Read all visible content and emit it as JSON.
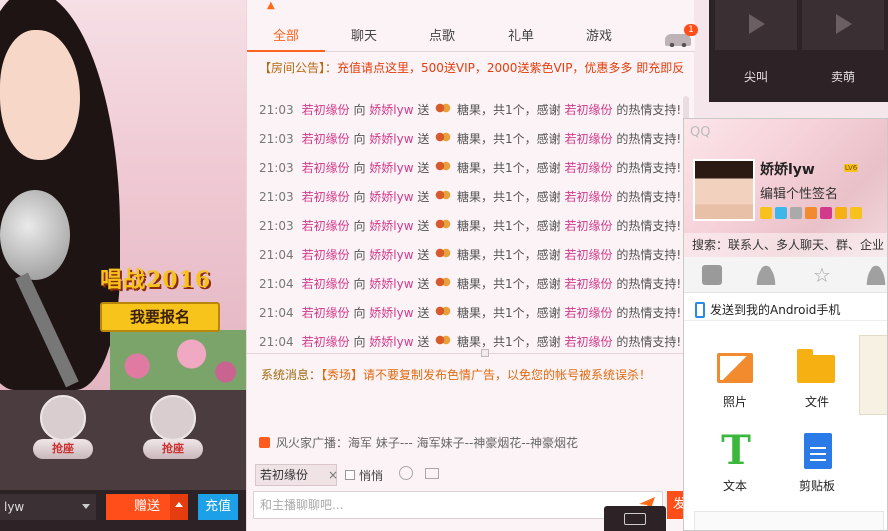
{
  "banner": {
    "title": "唱战2016",
    "button": "我要报名"
  },
  "seats": [
    {
      "label": "抢座"
    },
    {
      "label": "抢座"
    }
  ],
  "leftbar": {
    "user": "lyw",
    "gift_label": "赠送",
    "recharge_label": "充值"
  },
  "tabs": [
    {
      "label": "全部",
      "active": true
    },
    {
      "label": "聊天"
    },
    {
      "label": "点歌"
    },
    {
      "label": "礼单"
    },
    {
      "label": "游戏"
    }
  ],
  "car_badge": "1",
  "notice": {
    "label": "【房间公告】：",
    "text": "充值请点这里，500送VIP，2000送紫色VIP，优惠多多 即充即反"
  },
  "messages": [
    {
      "time": "21:03",
      "from": "若初缘份",
      "verb": "向",
      "to": "娇娇lyw",
      "send": "送",
      "rest": "糖果，共1个，感谢",
      "thank": "若初缘份",
      "tail": "的热情支持!"
    },
    {
      "time": "21:03",
      "from": "若初缘份",
      "verb": "向",
      "to": "娇娇lyw",
      "send": "送",
      "rest": "糖果，共1个，感谢",
      "thank": "若初缘份",
      "tail": "的热情支持!"
    },
    {
      "time": "21:03",
      "from": "若初缘份",
      "verb": "向",
      "to": "娇娇lyw",
      "send": "送",
      "rest": "糖果，共1个，感谢",
      "thank": "若初缘份",
      "tail": "的热情支持!"
    },
    {
      "time": "21:03",
      "from": "若初缘份",
      "verb": "向",
      "to": "娇娇lyw",
      "send": "送",
      "rest": "糖果，共1个，感谢",
      "thank": "若初缘份",
      "tail": "的热情支持!"
    },
    {
      "time": "21:03",
      "from": "若初缘份",
      "verb": "向",
      "to": "娇娇lyw",
      "send": "送",
      "rest": "糖果，共1个，感谢",
      "thank": "若初缘份",
      "tail": "的热情支持!"
    },
    {
      "time": "21:04",
      "from": "若初缘份",
      "verb": "向",
      "to": "娇娇lyw",
      "send": "送",
      "rest": "糖果，共1个，感谢",
      "thank": "若初缘份",
      "tail": "的热情支持!"
    },
    {
      "time": "21:04",
      "from": "若初缘份",
      "verb": "向",
      "to": "娇娇lyw",
      "send": "送",
      "rest": "糖果，共1个，感谢",
      "thank": "若初缘份",
      "tail": "的热情支持!"
    },
    {
      "time": "21:04",
      "from": "若初缘份",
      "verb": "向",
      "to": "娇娇lyw",
      "send": "送",
      "rest": "糖果，共1个，感谢",
      "thank": "若初缘份",
      "tail": "的热情支持!"
    },
    {
      "time": "21:04",
      "from": "若初缘份",
      "verb": "向",
      "to": "娇娇lyw",
      "send": "送",
      "rest": "糖果，共1个，感谢",
      "thank": "若初缘份",
      "tail": "的热情支持!"
    }
  ],
  "system": {
    "label": "系统消息：",
    "text": "【秀场】请不要复制发布色情广告，以免您的帐号被系统误杀！"
  },
  "broadcast": {
    "text": "风火家广播：海军 妹子--- 海军妹子--神豪烟花--神豪烟花"
  },
  "input": {
    "target": "若初缘份",
    "close": "×",
    "whisper": "悄悄",
    "placeholder": "和主播聊聊吧...",
    "send": "发"
  },
  "top_panel": [
    {
      "label": "尖叫"
    },
    {
      "label": "卖萌"
    }
  ],
  "qq": {
    "logo": "QQ",
    "name": "娇娇lyw",
    "level": "LV6",
    "signature": "编辑个性签名",
    "search": "搜索：联系人、多人聊天、群、企业",
    "send_to_phone": "发送到我的Android手机",
    "tiles": [
      {
        "label": "照片"
      },
      {
        "label": "文件"
      },
      {
        "label": "文本"
      },
      {
        "label": "剪贴板"
      }
    ],
    "text_glyph": "T"
  },
  "colors": {
    "accent": "#ff4e1a",
    "recharge": "#1ca0e8",
    "username": "#d23a8c",
    "notice": "#e53d0e"
  }
}
